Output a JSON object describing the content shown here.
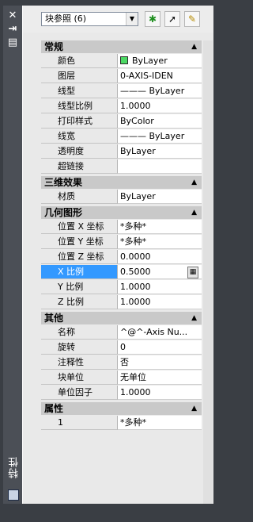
{
  "palette": {
    "title": "特性",
    "selector": {
      "value": "块参照 (6)"
    },
    "side_icons": [
      "close-icon",
      "autohide-icon",
      "properties-icon"
    ],
    "toolbar_icons": [
      "toggle-pickadd-icon",
      "select-objects-icon",
      "quick-select-icon"
    ],
    "sections": [
      {
        "title": "常规",
        "rows": [
          {
            "name": "颜色",
            "value": "ByLayer",
            "swatch": "#4cd964"
          },
          {
            "name": "图层",
            "value": "0-AXIS-IDEN"
          },
          {
            "name": "线型",
            "value": "——— ByLayer"
          },
          {
            "name": "线型比例",
            "value": "1.0000"
          },
          {
            "name": "打印样式",
            "value": "ByColor"
          },
          {
            "name": "线宽",
            "value": "——— ByLayer"
          },
          {
            "name": "透明度",
            "value": "ByLayer"
          },
          {
            "name": "超链接",
            "value": ""
          }
        ]
      },
      {
        "title": "三维效果",
        "rows": [
          {
            "name": "材质",
            "value": "ByLayer"
          }
        ]
      },
      {
        "title": "几何图形",
        "rows": [
          {
            "name": "位置 X 坐标",
            "value": "*多种*"
          },
          {
            "name": "位置 Y 坐标",
            "value": "*多种*"
          },
          {
            "name": "位置 Z 坐标",
            "value": "0.0000"
          },
          {
            "name": "X 比例",
            "value": "0.5000",
            "selected": true,
            "has_calc": true
          },
          {
            "name": "Y 比例",
            "value": "1.0000"
          },
          {
            "name": "Z 比例",
            "value": "1.0000"
          }
        ]
      },
      {
        "title": "其他",
        "rows": [
          {
            "name": "名称",
            "value": "^@^-Axis Nu..."
          },
          {
            "name": "旋转",
            "value": "0"
          },
          {
            "name": "注释性",
            "value": "否"
          },
          {
            "name": "块单位",
            "value": "无单位"
          },
          {
            "name": "单位因子",
            "value": "1.0000"
          }
        ]
      },
      {
        "title": "属性",
        "rows": [
          {
            "name": "1",
            "value": "*多种*"
          }
        ]
      }
    ]
  }
}
